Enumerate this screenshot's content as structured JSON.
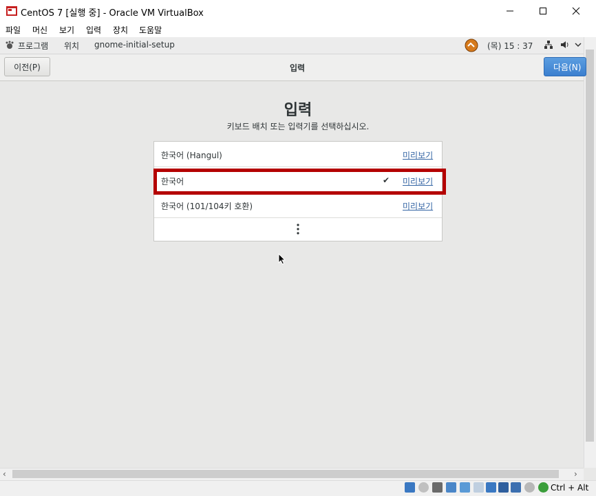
{
  "window": {
    "title": "CentOS 7 [실행 중] - Oracle VM VirtualBox",
    "controls": {
      "minimize": "—",
      "maximize": "☐",
      "close": "✕"
    }
  },
  "vbox_menu": [
    "파일",
    "머신",
    "보기",
    "입력",
    "장치",
    "도움말"
  ],
  "gnome_panel": {
    "apps": "프로그램",
    "places": "위치",
    "current_app": "gnome-initial-setup",
    "clock": "(목) 15 : 37"
  },
  "header": {
    "prev_label": "이전(P)",
    "title": "입력",
    "next_label": "다음(N)"
  },
  "main": {
    "heading": "입력",
    "subtitle": "키보드 배치 또는 입력기를 선택하십시오.",
    "layouts": [
      {
        "label": "한국어 (Hangul)",
        "preview": "미리보기",
        "selected": false
      },
      {
        "label": "한국어",
        "preview": "미리보기",
        "selected": true
      },
      {
        "label": "한국어 (101/104키 호환)",
        "preview": "미리보기",
        "selected": false
      }
    ],
    "check_glyph": "✔"
  },
  "status_bar": {
    "host_key": "Ctrl + Alt"
  },
  "scroll": {
    "left": "‹",
    "right": "›"
  },
  "colors": {
    "accent_blue": "#3b7fcf",
    "highlight_red": "#b40000",
    "link_blue": "#3465a4"
  }
}
